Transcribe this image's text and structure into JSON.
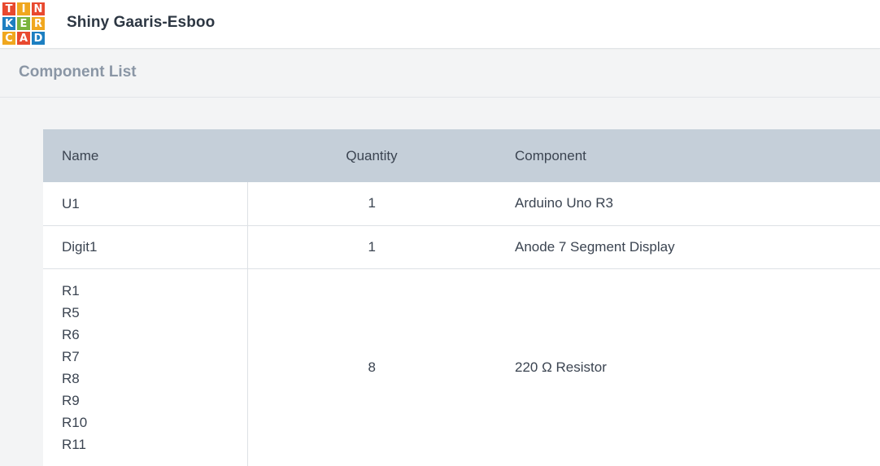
{
  "app": {
    "logo_letters": [
      "T",
      "I",
      "N",
      "K",
      "E",
      "R",
      "C",
      "A",
      "D"
    ],
    "logo_colors": [
      "#e8492f",
      "#f0a71f",
      "#e8492f",
      "#1d7fc1",
      "#7ab33e",
      "#f0a71f",
      "#f0a71f",
      "#e8492f",
      "#1d7fc1"
    ],
    "title": "Shiny Gaaris-Esboo"
  },
  "page": {
    "title": "Component List"
  },
  "table": {
    "headers": {
      "name": "Name",
      "quantity": "Quantity",
      "component": "Component"
    },
    "rows": [
      {
        "names": [
          "U1"
        ],
        "quantity": "1",
        "component": "Arduino Uno R3"
      },
      {
        "names": [
          "Digit1"
        ],
        "quantity": "1",
        "component": "Anode 7 Segment Display"
      },
      {
        "names": [
          "R1",
          "R5",
          "R6",
          "R7",
          "R8",
          "R9",
          "R10",
          "R11"
        ],
        "quantity": "8",
        "component": "220 Ω Resistor"
      }
    ]
  }
}
